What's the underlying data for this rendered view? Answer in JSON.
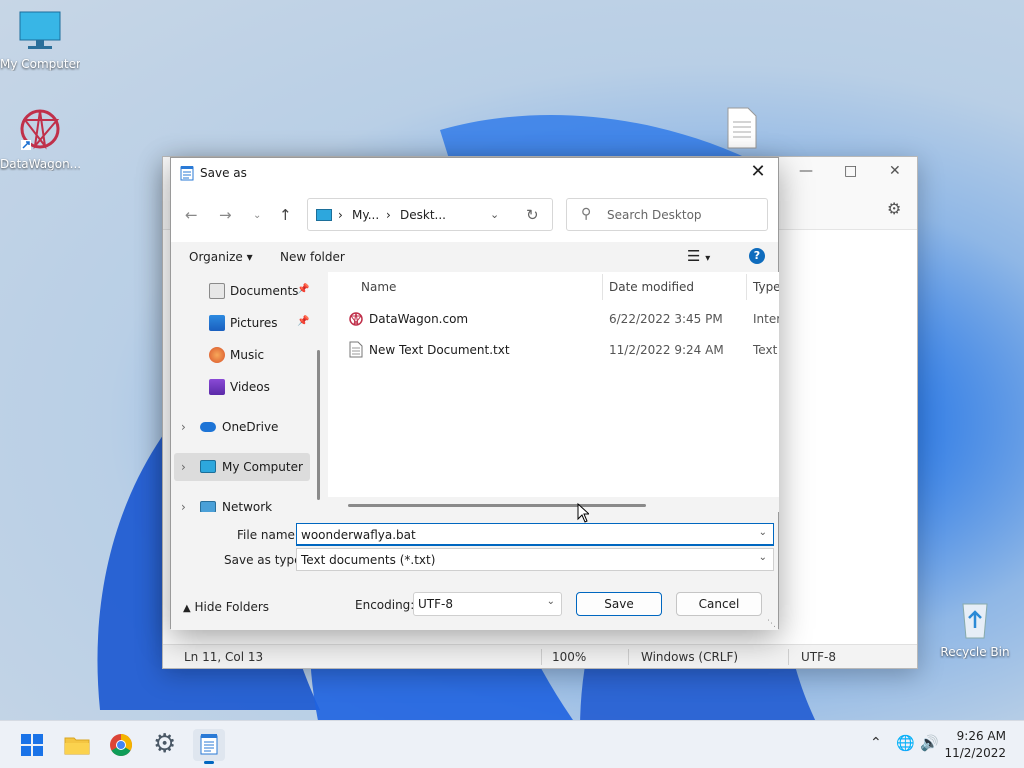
{
  "desktop": {
    "icons": [
      {
        "label": "My Computer"
      },
      {
        "label": "DataWagon..."
      },
      {
        "label": "Recycle Bin"
      }
    ]
  },
  "notepad": {
    "status": {
      "position": "Ln 11, Col 13",
      "zoom": "100%",
      "eol": "Windows (CRLF)",
      "encoding": "UTF-8"
    }
  },
  "dialog": {
    "title": "Save as",
    "address": {
      "crumb1": "My...",
      "crumb2": "Deskt..."
    },
    "search_placeholder": "Search Desktop",
    "toolbar": {
      "organize": "Organize",
      "new_folder": "New folder"
    },
    "nav": [
      {
        "label": "Documents"
      },
      {
        "label": "Pictures"
      },
      {
        "label": "Music"
      },
      {
        "label": "Videos"
      },
      {
        "label": "OneDrive"
      },
      {
        "label": "My Computer"
      },
      {
        "label": "Network"
      }
    ],
    "columns": {
      "name": "Name",
      "date": "Date modified",
      "type": "Type"
    },
    "files": [
      {
        "name": "DataWagon.com",
        "date": "6/22/2022 3:45 PM",
        "type": "Interr"
      },
      {
        "name": "New Text Document.txt",
        "date": "11/2/2022 9:24 AM",
        "type": "Text D"
      }
    ],
    "file_name_label": "File name:",
    "file_name_value": "woonderwaflya.bat",
    "save_type_label": "Save as type:",
    "save_type_value": "Text documents (*.txt)",
    "hide_folders": "Hide Folders",
    "encoding_label": "Encoding:",
    "encoding_value": "UTF-8",
    "save": "Save",
    "cancel": "Cancel"
  },
  "tray": {
    "time": "9:26 AM",
    "date": "11/2/2022"
  }
}
